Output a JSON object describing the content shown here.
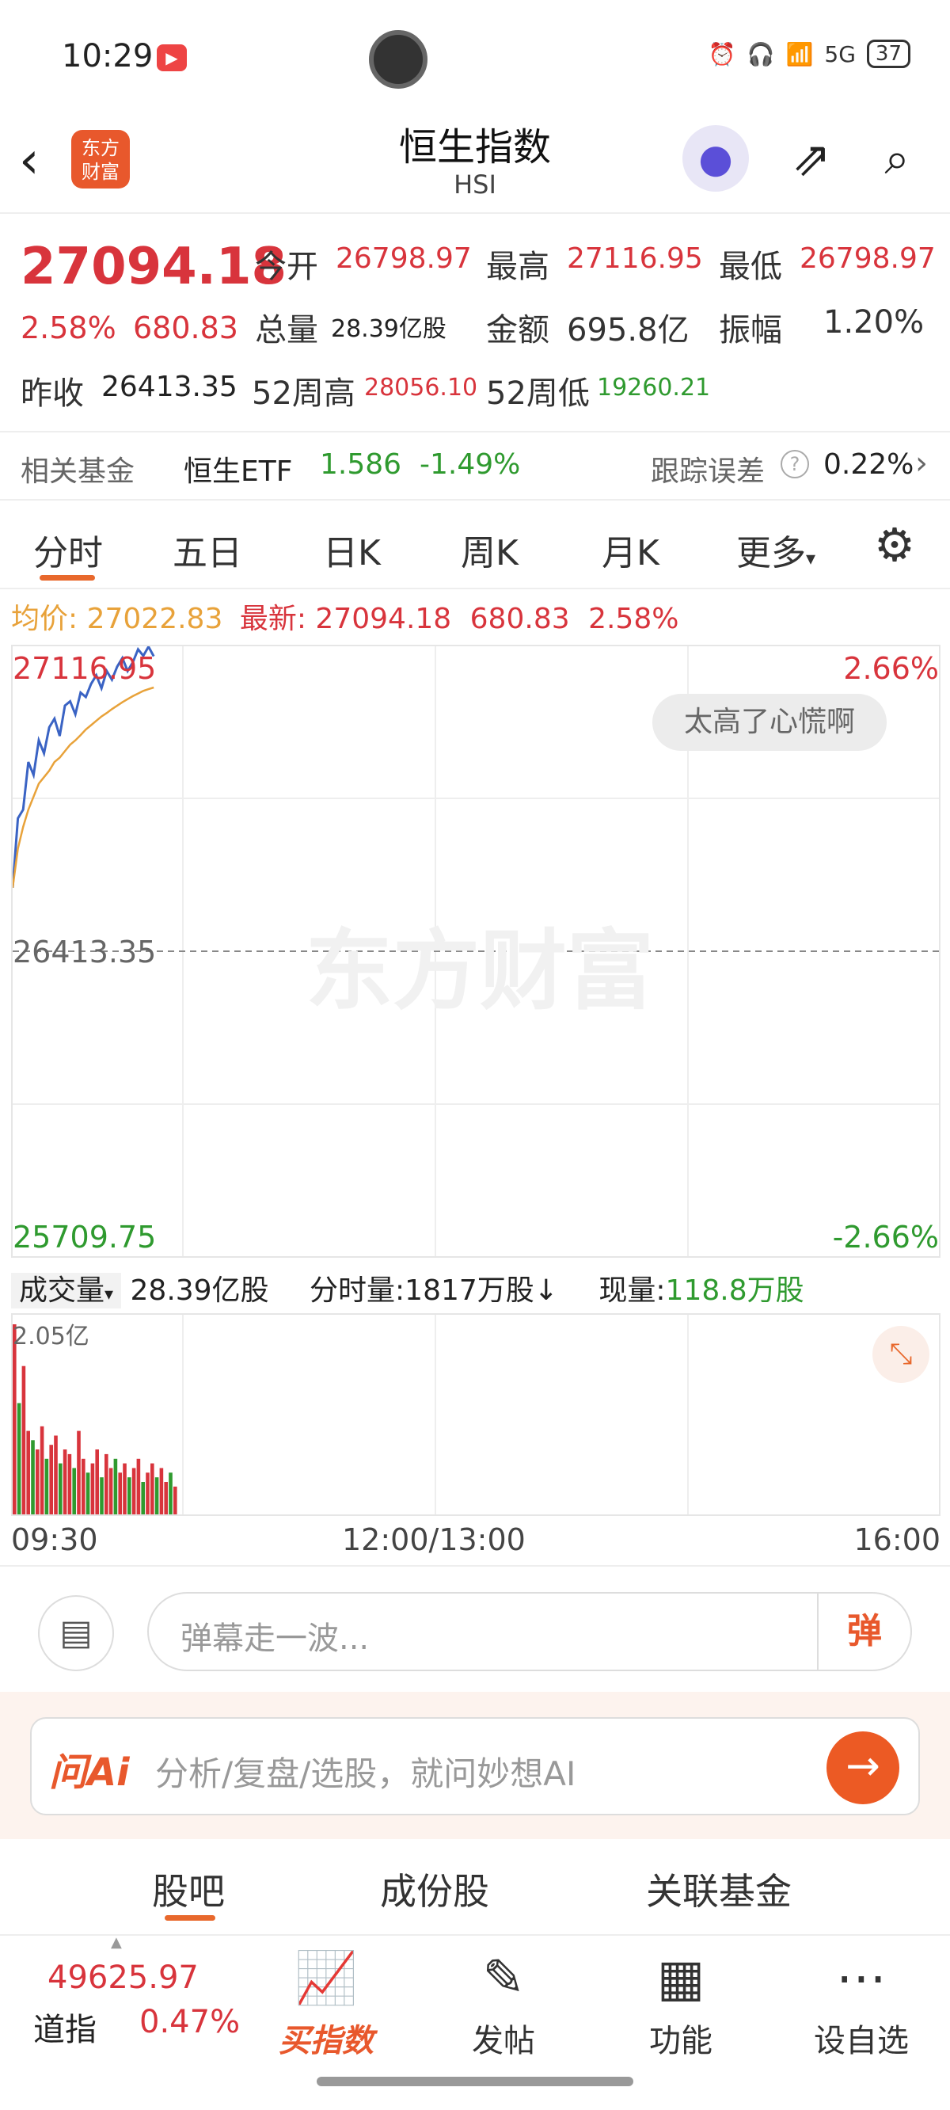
{
  "status_bar": {
    "time": "10:29",
    "network": "5G",
    "battery": "37"
  },
  "header": {
    "back_icon": "chevron-left-icon",
    "logo_text_1": "东方",
    "logo_text_2": "财富",
    "title": "恒生指数",
    "subtitle": "HSI",
    "robot_icon": "ai-robot-icon",
    "share_icon": "share-icon",
    "search_icon": "search-icon"
  },
  "quote": {
    "price": "27094.18",
    "pct": "2.58%",
    "change": "680.83",
    "open_label": "今开",
    "open": "26798.97",
    "high_label": "最高",
    "high": "27116.95",
    "low_label": "最低",
    "low": "26798.97",
    "volume_label": "总量",
    "volume": "28.39亿股",
    "amount_label": "金额",
    "amount": "695.8亿",
    "amplitude_label": "振幅",
    "amplitude": "1.20%",
    "prev_close_label": "昨收",
    "prev_close": "26413.35",
    "week52_high_label": "52周高",
    "week52_high": "28056.10",
    "week52_low_label": "52周低",
    "week52_low": "19260.21"
  },
  "fund_row": {
    "label": "相关基金",
    "fund_name": "恒生ETF",
    "fund_price": "1.586",
    "fund_pct": "-1.49%",
    "tracking_label": "跟踪误差",
    "tracking_value": "0.22%"
  },
  "tabs": [
    "分时",
    "五日",
    "日K",
    "周K",
    "月K",
    "更多"
  ],
  "active_tab": "分时",
  "avg_line": {
    "avg_label": "均价:",
    "avg_value": "27022.83",
    "latest_label": "最新:",
    "latest_value": "27094.18",
    "latest_change": "680.83",
    "latest_pct": "2.58%"
  },
  "chart": {
    "top_value": "27116.95",
    "top_pct": "2.66%",
    "mid_value": "26413.35",
    "bottom_value": "25709.75",
    "bottom_pct": "-2.66%",
    "bubble": "太高了心慌啊",
    "watermark": "东方财富"
  },
  "volume_row": {
    "selector": "成交量",
    "total": "28.39亿股",
    "minute_label": "分时量:1817万股↓",
    "current_label": "现量:",
    "current_value": "118.8万股",
    "max_label": "2.05亿"
  },
  "time_axis": [
    "09:30",
    "12:00/13:00",
    "16:00"
  ],
  "danmu": {
    "placeholder": "弹幕走一波...",
    "button": "弹"
  },
  "ai": {
    "logo": "问Ai",
    "placeholder": "分析/复盘/选股，就问妙想AI"
  },
  "bottom_tabs": [
    "股吧",
    "成份股",
    "关联基金"
  ],
  "nav": {
    "index_value": "49625.97",
    "index_name": "道指",
    "index_pct": "0.47%",
    "buy_label": "买指数",
    "post_label": "发帖",
    "func_label": "功能",
    "watch_label": "设自选"
  },
  "chart_data": {
    "type": "line",
    "title": "",
    "xlabel": "",
    "ylabel": "",
    "x_range": [
      "09:30",
      "16:00"
    ],
    "ylim": [
      25709.75,
      27116.95
    ],
    "reference": 26413.35,
    "series": [
      {
        "name": "最新",
        "color": "#3a63c4",
        "values": [
          26560,
          26720,
          26740,
          26850,
          26820,
          26900,
          26870,
          26930,
          26950,
          26910,
          26980,
          26990,
          26960,
          27010,
          27000,
          27030,
          27050,
          27020,
          27060,
          27040,
          27070,
          27090,
          27060,
          27080,
          27110,
          27095,
          27116,
          27094
        ]
      },
      {
        "name": "均价",
        "color": "#e8a23a",
        "values": [
          26560,
          26650,
          26700,
          26740,
          26770,
          26800,
          26815,
          26830,
          26850,
          26860,
          26875,
          26890,
          26900,
          26912,
          26925,
          26935,
          26945,
          26955,
          26963,
          26972,
          26980,
          26988,
          26995,
          27002,
          27008,
          27014,
          27018,
          27022
        ]
      }
    ],
    "volume": [
      205,
      120,
      160,
      90,
      80,
      70,
      95,
      60,
      75,
      85,
      55,
      70,
      65,
      50,
      90,
      60,
      45,
      55,
      70,
      40,
      65,
      50,
      60,
      45,
      55,
      40,
      50,
      60,
      35,
      45,
      55,
      40,
      50,
      35,
      45,
      30
    ],
    "volume_colors": [
      "#d8343c",
      "#2f9a2f"
    ]
  }
}
